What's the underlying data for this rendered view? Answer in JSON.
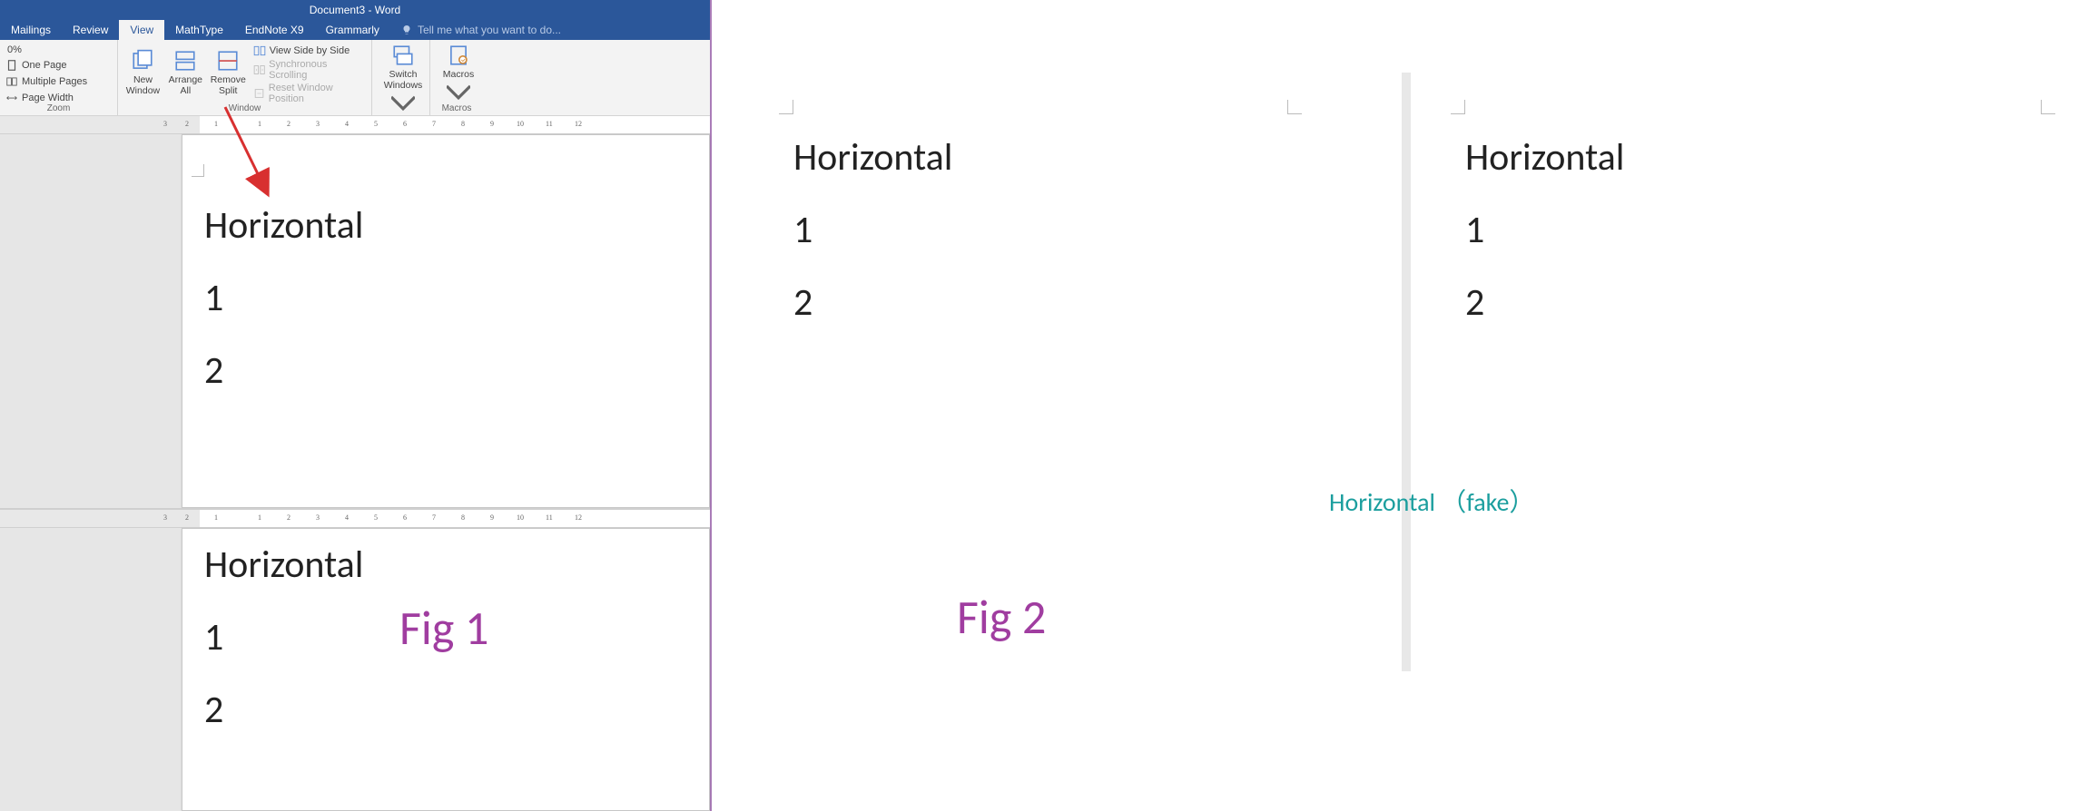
{
  "title": "Document3 - Word",
  "tabs": [
    "Mailings",
    "Review",
    "View",
    "MathType",
    "EndNote X9",
    "Grammarly"
  ],
  "active_tab": "View",
  "tell_me": "Tell me what you want to do...",
  "zoom_pct": "0%",
  "zoom": {
    "one_page": "One Page",
    "multiple": "Multiple Pages",
    "page_width": "Page Width",
    "group": "Zoom"
  },
  "window_grp": {
    "new_window": "New\nWindow",
    "arrange_all": "Arrange\nAll",
    "remove_split": "Remove\nSplit",
    "side_by_side": "View Side by Side",
    "sync_scroll": "Synchronous Scrolling",
    "reset_pos": "Reset Window Position",
    "switch": "Switch\nWindows",
    "group": "Window"
  },
  "macros": {
    "label": "Macros",
    "group": "Macros"
  },
  "doc": {
    "line1": "Horizontal",
    "line2": "1",
    "line3": "2"
  },
  "fig2_doc": {
    "line1": "Horizontal",
    "line2": "1",
    "line3": "2"
  },
  "fake_label": "Horizontal （fake）",
  "fig1_caption": "Fig 1",
  "fig2_caption": "Fig 2"
}
